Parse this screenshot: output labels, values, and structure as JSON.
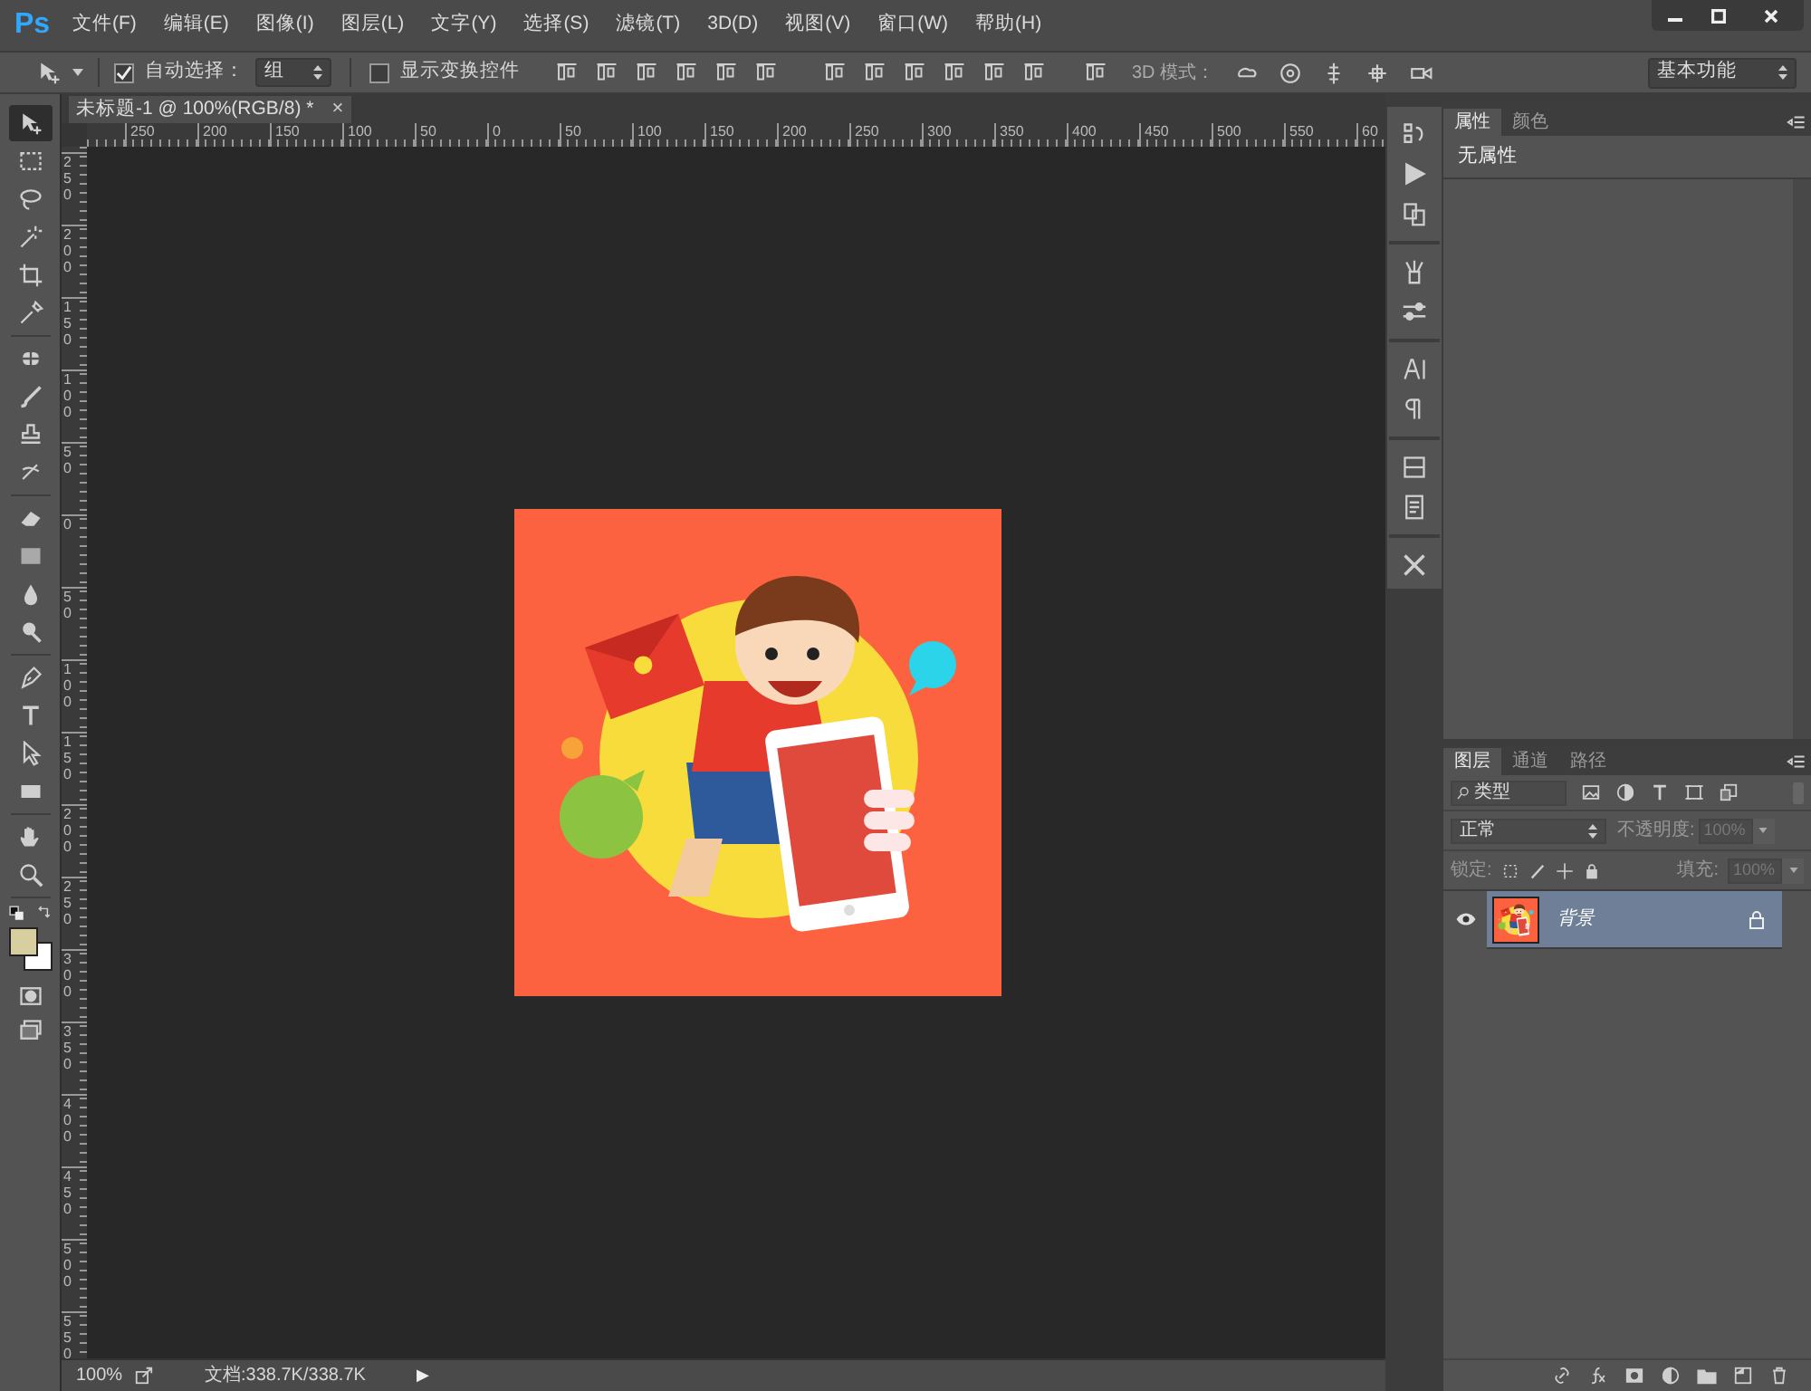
{
  "app_logo": "Ps",
  "menu": [
    "文件(F)",
    "编辑(E)",
    "图像(I)",
    "图层(L)",
    "文字(Y)",
    "选择(S)",
    "滤镜(T)",
    "3D(D)",
    "视图(V)",
    "窗口(W)",
    "帮助(H)"
  ],
  "options_bar": {
    "auto_select": {
      "label": "自动选择：",
      "checked": true
    },
    "auto_select_target": "组",
    "show_transform": {
      "label": "显示变换控件",
      "checked": false
    },
    "mode_3d_label": "3D 模式：",
    "workspace": "基本功能"
  },
  "document_tab": {
    "title": "未标题-1 @ 100%(RGB/8) *",
    "close": "×"
  },
  "rulers": {
    "horizontal": [
      "250",
      "200",
      "150",
      "100",
      "50",
      "0",
      "50",
      "100",
      "150",
      "200",
      "250",
      "300",
      "350",
      "400",
      "450",
      "500",
      "550",
      "60"
    ],
    "vertical": [
      "250",
      "200",
      "150",
      "100",
      "50",
      "0",
      "50",
      "100",
      "150",
      "200",
      "250",
      "300",
      "350",
      "400",
      "450",
      "500",
      "550"
    ]
  },
  "tools": [
    {
      "kind": "move",
      "selected": true
    },
    {
      "kind": "marquee",
      "selected": false
    },
    {
      "kind": "lasso",
      "selected": false
    },
    {
      "kind": "wand",
      "selected": false
    },
    {
      "kind": "crop",
      "selected": false
    },
    {
      "kind": "eyedropper",
      "selected": false
    },
    {
      "kind": "healing",
      "selected": false
    },
    {
      "kind": "brush",
      "selected": false
    },
    {
      "kind": "stamp",
      "selected": false
    },
    {
      "kind": "history",
      "selected": false
    },
    {
      "kind": "eraser",
      "selected": false
    },
    {
      "kind": "gradient",
      "selected": false
    },
    {
      "kind": "blur",
      "selected": false
    },
    {
      "kind": "dodge",
      "selected": false
    },
    {
      "kind": "pen",
      "selected": false
    },
    {
      "kind": "type",
      "selected": false
    },
    {
      "kind": "select",
      "selected": false
    },
    {
      "kind": "rectangle",
      "selected": false
    },
    {
      "kind": "hand",
      "selected": false
    },
    {
      "kind": "zoom",
      "selected": false
    }
  ],
  "status_bar": {
    "zoom": "100%",
    "doc_info": "文档:338.7K/338.7K",
    "menu_arrow": "▶"
  },
  "properties_panel": {
    "tabs": [
      {
        "label": "属性",
        "selected": true
      },
      {
        "label": "颜色",
        "selected": false
      }
    ],
    "content": "无属性"
  },
  "layers_panel": {
    "tabs": [
      {
        "label": "图层",
        "selected": true
      },
      {
        "label": "通道",
        "selected": false
      },
      {
        "label": "路径",
        "selected": false
      }
    ],
    "filter": "类型",
    "blend_mode": "正常",
    "opacity_label": "不透明度:",
    "opacity": "100%",
    "lock_label": "锁定:",
    "fill_label": "填充:",
    "fill": "100%",
    "layers": [
      {
        "name": "背景",
        "visible": true,
        "selected": true,
        "locked": true
      }
    ]
  }
}
